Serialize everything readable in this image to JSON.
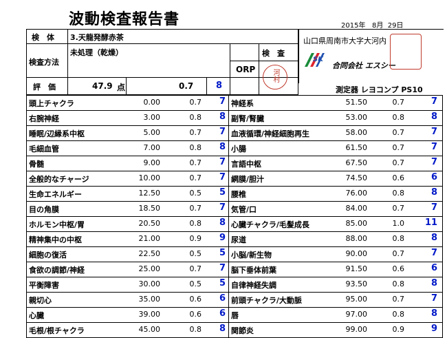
{
  "title": "波動検査報告書",
  "date": "2015年   8月  29日",
  "header": {
    "sample_label": "検　体",
    "sample_value": "3.天龍発酵赤茶",
    "method_label": "検査方法",
    "method_value": "未処理（乾燥）",
    "inspect_label": "検　査",
    "orp_label": "ORP",
    "eval_label": "評　価",
    "eval_score": "47.9",
    "eval_unit": "点",
    "eval_coef": "0.7",
    "eval_level": "8"
  },
  "company": {
    "address": "山口県周南市大字大河内",
    "name": "合同会社 エスシー",
    "logo_text": "SK",
    "instrument": "測定器 レヨコンプ PS10",
    "seal_text": "河村"
  },
  "left_rows": [
    {
      "name": "頭上チャクラ",
      "v1": "0.00",
      "v2": "0.7",
      "lvl": "7"
    },
    {
      "name": "右腕神経",
      "v1": "3.00",
      "v2": "0.8",
      "lvl": "8"
    },
    {
      "name": "睡眠/辺縁系中枢",
      "v1": "5.00",
      "v2": "0.7",
      "lvl": "7"
    },
    {
      "name": "毛細血管",
      "v1": "7.00",
      "v2": "0.8",
      "lvl": "8"
    },
    {
      "name": "骨髄",
      "v1": "9.00",
      "v2": "0.7",
      "lvl": "7"
    },
    {
      "name": "全般的なチャージ",
      "v1": "10.00",
      "v2": "0.7",
      "lvl": "7"
    },
    {
      "name": "生命エネルギー",
      "v1": "12.50",
      "v2": "0.5",
      "lvl": "5"
    },
    {
      "name": "目の角膜",
      "v1": "18.50",
      "v2": "0.7",
      "lvl": "7"
    },
    {
      "name": "ホルモン中枢/胃",
      "v1": "20.50",
      "v2": "0.8",
      "lvl": "8"
    },
    {
      "name": "精神集中の中枢",
      "v1": "21.00",
      "v2": "0.9",
      "lvl": "9"
    },
    {
      "name": "細胞の復活",
      "v1": "22.50",
      "v2": "0.5",
      "lvl": "5"
    },
    {
      "name": "食欲の調節/神経",
      "v1": "25.00",
      "v2": "0.7",
      "lvl": "7"
    },
    {
      "name": "平衡障害",
      "v1": "30.00",
      "v2": "0.5",
      "lvl": "5"
    },
    {
      "name": "親切心",
      "v1": "35.00",
      "v2": "0.6",
      "lvl": "6"
    },
    {
      "name": "心臓",
      "v1": "39.00",
      "v2": "0.6",
      "lvl": "6"
    },
    {
      "name": "毛根/根チャクラ",
      "v1": "45.00",
      "v2": "0.8",
      "lvl": "8"
    }
  ],
  "right_rows": [
    {
      "name": "神経系",
      "v1": "51.50",
      "v2": "0.7",
      "lvl": "7"
    },
    {
      "name": "副腎/腎臓",
      "v1": "53.00",
      "v2": "0.8",
      "lvl": "8"
    },
    {
      "name": "血液循環/神経細胞再生",
      "v1": "58.00",
      "v2": "0.7",
      "lvl": "7"
    },
    {
      "name": "小腸",
      "v1": "61.50",
      "v2": "0.7",
      "lvl": "7"
    },
    {
      "name": "言語中枢",
      "v1": "67.50",
      "v2": "0.7",
      "lvl": "7"
    },
    {
      "name": "網膜/胆汁",
      "v1": "74.50",
      "v2": "0.6",
      "lvl": "6"
    },
    {
      "name": "腰椎",
      "v1": "76.00",
      "v2": "0.8",
      "lvl": "8"
    },
    {
      "name": "気管/口",
      "v1": "84.00",
      "v2": "0.7",
      "lvl": "7"
    },
    {
      "name": "心臓チャクラ/毛髪成長",
      "v1": "85.00",
      "v2": "1.0",
      "lvl": "11"
    },
    {
      "name": "尿道",
      "v1": "88.00",
      "v2": "0.8",
      "lvl": "8"
    },
    {
      "name": "小脳/新生物",
      "v1": "90.00",
      "v2": "0.7",
      "lvl": "7"
    },
    {
      "name": "脳下垂体前葉",
      "v1": "91.50",
      "v2": "0.6",
      "lvl": "6"
    },
    {
      "name": "自律神経失調",
      "v1": "93.50",
      "v2": "0.8",
      "lvl": "8"
    },
    {
      "name": "前頭チャクラ/大動脈",
      "v1": "95.00",
      "v2": "0.7",
      "lvl": "7"
    },
    {
      "name": "唇",
      "v1": "97.00",
      "v2": "0.8",
      "lvl": "8"
    },
    {
      "name": "関節炎",
      "v1": "99.00",
      "v2": "0.9",
      "lvl": "9"
    }
  ]
}
